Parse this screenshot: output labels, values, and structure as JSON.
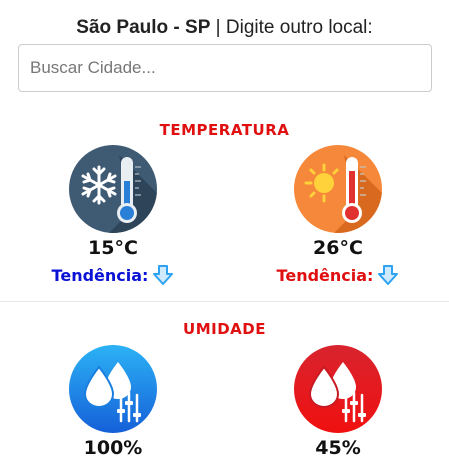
{
  "header": {
    "location": "São Paulo - SP",
    "separator": " | ",
    "prompt": "Digite outro local:"
  },
  "search": {
    "placeholder": "Buscar Cidade...",
    "value": ""
  },
  "temperature": {
    "title": "TEMPERATURA",
    "min": {
      "value": "15°C",
      "trend_label": "Tendência:",
      "trend_color": "#0a12d6",
      "trend_icon": "arrow-down-icon",
      "icon": "cold-thermometer-icon"
    },
    "max": {
      "value": "26°C",
      "trend_label": "Tendência:",
      "trend_color": "#e01010",
      "trend_icon": "arrow-down-icon",
      "icon": "hot-thermometer-icon"
    }
  },
  "humidity": {
    "title": "UMIDADE",
    "max": {
      "value": "100%",
      "icon": "humidity-high-icon"
    },
    "min": {
      "value": "45%",
      "icon": "humidity-low-icon"
    }
  },
  "colors": {
    "accent_red": "#e01010",
    "accent_blue": "#0a12d6",
    "arrow_blue": "#2ea3f2"
  }
}
